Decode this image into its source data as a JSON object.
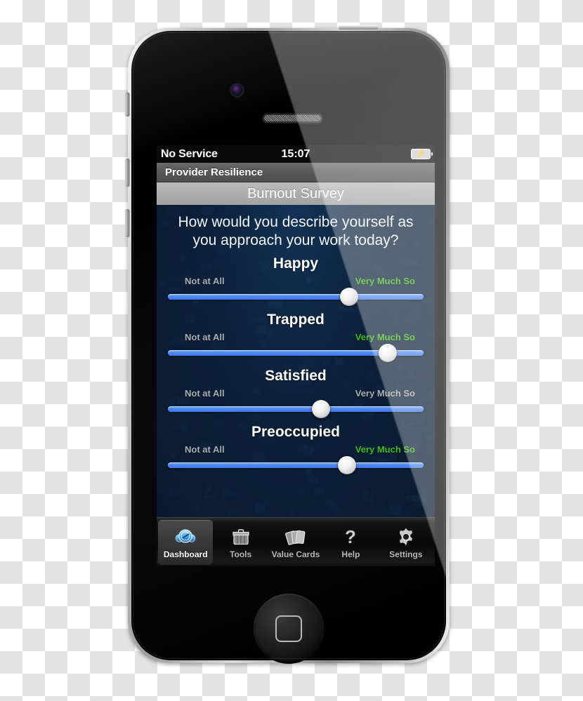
{
  "status_bar": {
    "carrier": "No Service",
    "clock": "15:07",
    "battery_icon": "battery-charging-icon",
    "battery_bolt_glyph": "⚡"
  },
  "nav_bar": {
    "title": "Provider Resilience"
  },
  "survey": {
    "title": "Burnout Survey",
    "question": "How would you describe yourself as you approach your work today?",
    "colors": {
      "screen_background": "#0b1d33",
      "track_blue": "#4d86f0",
      "anchor_green": "#3fbf1f",
      "anchor_gray": "#a7b0b8",
      "nav_bar_gray": "#575757",
      "title_bar_gray": "#ababab"
    },
    "items": [
      {
        "label": "Happy",
        "anchor_low": "Not at All",
        "anchor_high": "Very Much So",
        "anchor_high_color": "#3fbf1f",
        "value_percent": 71
      },
      {
        "label": "Trapped",
        "anchor_low": "Not at All",
        "anchor_high": "Very Much So",
        "anchor_high_color": "#3fbf1f",
        "value_percent": 86
      },
      {
        "label": "Satisfied",
        "anchor_low": "Not at All",
        "anchor_high": "Very Much So",
        "anchor_high_color": "#a7b0b8",
        "value_percent": 60
      },
      {
        "label": "Preoccupied",
        "anchor_low": "Not at All",
        "anchor_high": "Very Much So",
        "anchor_high_color": "#3fbf1f",
        "value_percent": 70
      }
    ]
  },
  "tab_bar": {
    "items": [
      {
        "label": "Dashboard",
        "icon": "gauge-dashboard-icon",
        "selected": true
      },
      {
        "label": "Tools",
        "icon": "toolbox-icon",
        "selected": false
      },
      {
        "label": "Value Cards",
        "icon": "cards-icon",
        "selected": false
      },
      {
        "label": "Help",
        "icon": "question-mark-icon",
        "selected": false
      },
      {
        "label": "Settings",
        "icon": "gear-icon",
        "selected": false
      }
    ]
  },
  "device": {
    "hardware": {
      "front_camera": "front-camera-icon",
      "earpiece_speaker": "earpiece-speaker-icon",
      "home_button": "home-button",
      "mute_switch": "mute-switch",
      "volume_up": "volume-up-button",
      "volume_down": "volume-down-button",
      "power_button": "power-button"
    }
  }
}
